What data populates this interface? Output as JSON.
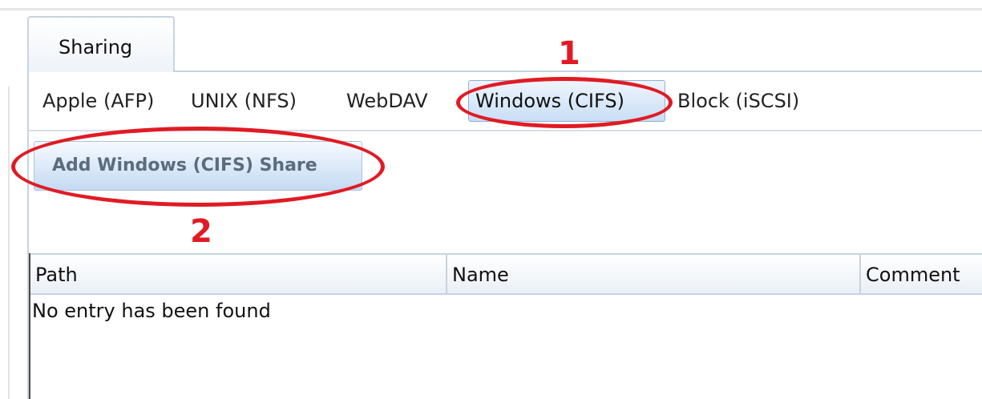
{
  "main_tabs": [
    {
      "label": "Sharing",
      "active": true
    }
  ],
  "sub_tabs": [
    {
      "label": "Apple (AFP)",
      "active": false
    },
    {
      "label": "UNIX (NFS)",
      "active": false
    },
    {
      "label": "WebDAV",
      "active": false
    },
    {
      "label": "Windows (CIFS)",
      "active": true
    },
    {
      "label": "Block (iSCSI)",
      "active": false
    }
  ],
  "toolbar": {
    "add_button_label": "Add Windows (CIFS) Share"
  },
  "grid": {
    "columns": [
      "Path",
      "Name",
      "Comment"
    ],
    "rows": [],
    "empty_message": "No entry has been found"
  },
  "annotations": [
    {
      "number": "1",
      "target": "Windows (CIFS)"
    },
    {
      "number": "2",
      "target": "Add Windows (CIFS) Share"
    }
  ],
  "colors": {
    "annotation": "#e01b24",
    "active_tab_fill": "#c9def5",
    "border": "#c6d4e2"
  }
}
